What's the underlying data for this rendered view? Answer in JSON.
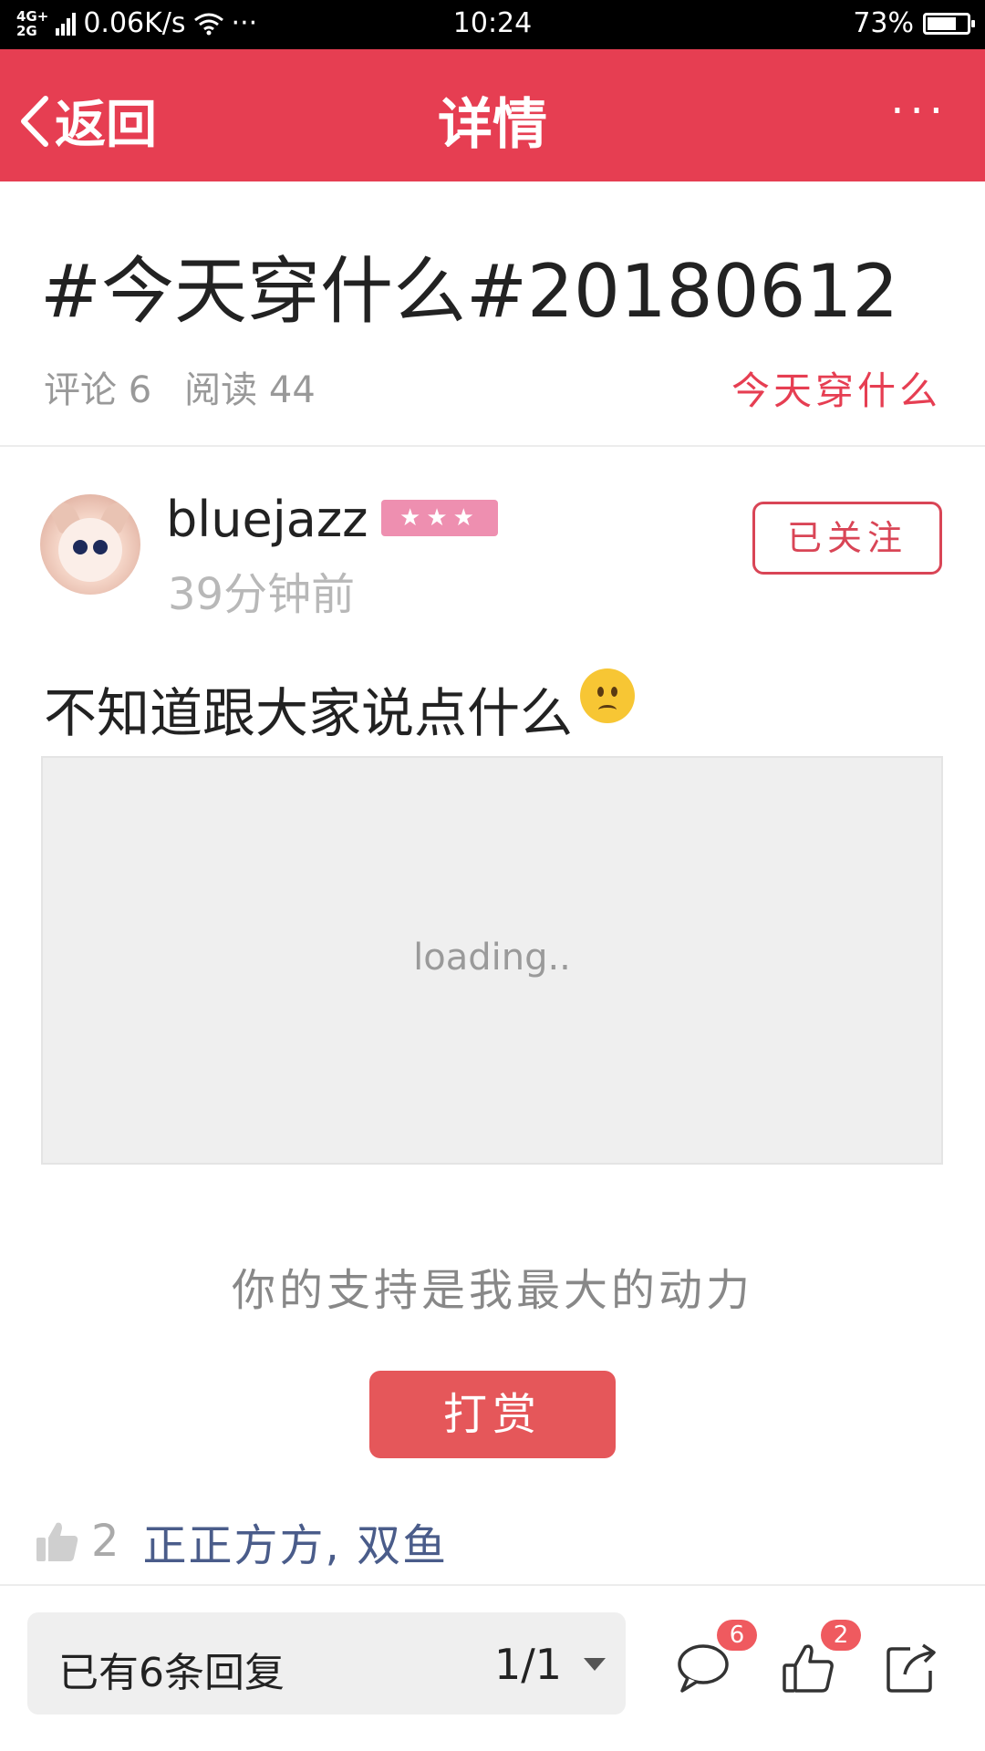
{
  "status_bar": {
    "network": "4G+\n2G",
    "speed": "0.06K/s",
    "dots": "···",
    "time": "10:24",
    "battery_text": "73%",
    "battery_level": 0.73
  },
  "nav": {
    "back_label": "返回",
    "title": "详情",
    "more": "···"
  },
  "post": {
    "title": "#今天穿什么#20180612",
    "comments_label": "评论 6",
    "reads_label": "阅读 44",
    "topic": "今天穿什么"
  },
  "author": {
    "name": "bluejazz",
    "level_stars": "★★★",
    "time": "39分钟前",
    "follow_label": "已关注"
  },
  "content": {
    "text": "不知道跟大家说点什么",
    "emoji": "worried-face-emoji",
    "image_loading": "loading.."
  },
  "support": {
    "text": "你的支持是我最大的动力",
    "reward_label": "打赏"
  },
  "likes": {
    "count": "2",
    "users": "正正方方, 双鱼"
  },
  "bottom_bar": {
    "reply_text": "已有6条回复",
    "page": "1/1",
    "comment_badge": "6",
    "like_badge": "2"
  },
  "colors": {
    "accent": "#e63e52",
    "reward": "#e5575a",
    "liker": "#4a5c8a"
  }
}
